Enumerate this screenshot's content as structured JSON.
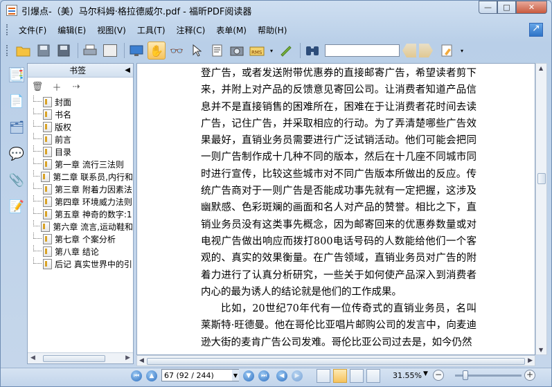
{
  "window": {
    "title": "引爆点-（美）马尔科姆·格拉德威尔.pdf - 福昕PDF阅读器",
    "controls": {
      "minimize": "—",
      "maximize": "□",
      "close": "✕"
    }
  },
  "menubar": {
    "items": [
      "文件(F)",
      "编辑(E)",
      "视图(V)",
      "工具(T)",
      "注释(C)",
      "表单(M)",
      "帮助(H)"
    ]
  },
  "toolbar": {
    "search_value": "",
    "buttons": [
      "open-folder-icon",
      "save-icon",
      "save-as-icon",
      "print-icon",
      "scan-icon",
      "fullscreen-icon",
      "hand-tool-icon",
      "snapshot-zoom-icon",
      "select-cursor-icon",
      "text-select-icon",
      "camera-icon",
      "rms-icon",
      "sign-pen-icon",
      "binoculars-icon",
      "prev-result-icon",
      "next-result-icon",
      "highlight-icon"
    ]
  },
  "sidebar": {
    "panel_title": "书签",
    "collapse": "◀",
    "bookmarks": [
      {
        "label": "封面"
      },
      {
        "label": "书名"
      },
      {
        "label": "版权"
      },
      {
        "label": "前言"
      },
      {
        "label": "目录"
      },
      {
        "label": "第一章 流行三法则"
      },
      {
        "label": "第二章 联系员,内行和"
      },
      {
        "label": "第三章 附着力因素法"
      },
      {
        "label": "第四章 环境威力法则"
      },
      {
        "label": "第五章 神奇的数字:1"
      },
      {
        "label": "第六章 流言,运动鞋和"
      },
      {
        "label": "第七章 个案分析"
      },
      {
        "label": "第八章 结论"
      },
      {
        "label": "后记 真实世界中的引"
      }
    ]
  },
  "document": {
    "paragraphs": [
      {
        "indent": false,
        "text": "登广告，或者发送附带优惠券的直接邮寄广告，希望读者剪下来，并附上对产品的反馈意见寄回公司。让消费者知道产品信息并不是直接销售的困难所在，困难在于让消费者花时间去读广告，记住广告，并采取相应的行动。为了弄清楚哪些广告效果最好，直销业务员需要进行广泛试销活动。他们可能会把同一则广告制作成十几种不同的版本，然后在十几座不同城市同时进行宣传，比较这些城市对不同广告版本所做出的反应。传统广告商对于一则广告是否能成功事先就有一定把握，这涉及幽默感、色彩斑斓的画面和名人对产品的赞誉。相比之下，直销业务员没有这类事先概念，因为邮寄回来的优惠券数量或对电视广告做出响应而拨打800电话号码的人数能给他们一个客观的、真实的效果衡量。在广告领域，直销业务员对广告的附着力进行了认真分析研究，一些关于如何使产品深入到消费者内心的最为诱人的结论就是他们的工作成果。"
      },
      {
        "indent": true,
        "text": "比如，20世纪70年代有一位传奇式的直销业务员，名叫莱斯特·旺德曼。他在哥伦比亚唱片邮购公司的发言中，向麦迪逊大街的麦肯广告公司发难。哥伦比亚公司过去是，如今仍然"
      }
    ]
  },
  "statusbar": {
    "page_value": "67 (92 / 244)",
    "zoom": "31.55%",
    "zoom_level": 0.12
  }
}
